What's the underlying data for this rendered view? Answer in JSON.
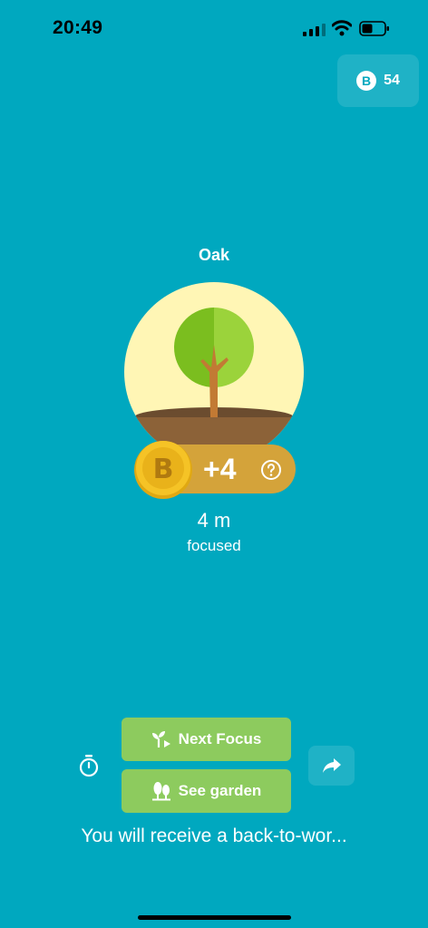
{
  "status_bar": {
    "time": "20:49"
  },
  "header": {
    "coin_icon_letter": "B",
    "coin_count": "54"
  },
  "tree": {
    "name": "Oak"
  },
  "reward": {
    "coin_letter": "B",
    "amount": "+4"
  },
  "session": {
    "duration": "4 m",
    "label": "focused"
  },
  "actions": {
    "next_focus_label": "Next Focus",
    "see_garden_label": "See garden"
  },
  "notice": {
    "text": "You will receive a back-to-wor..."
  },
  "colors": {
    "background": "#00A8BF",
    "button": "#8DCB5E",
    "coin": "#F5C326",
    "reward_pill": "#D4A33A"
  }
}
